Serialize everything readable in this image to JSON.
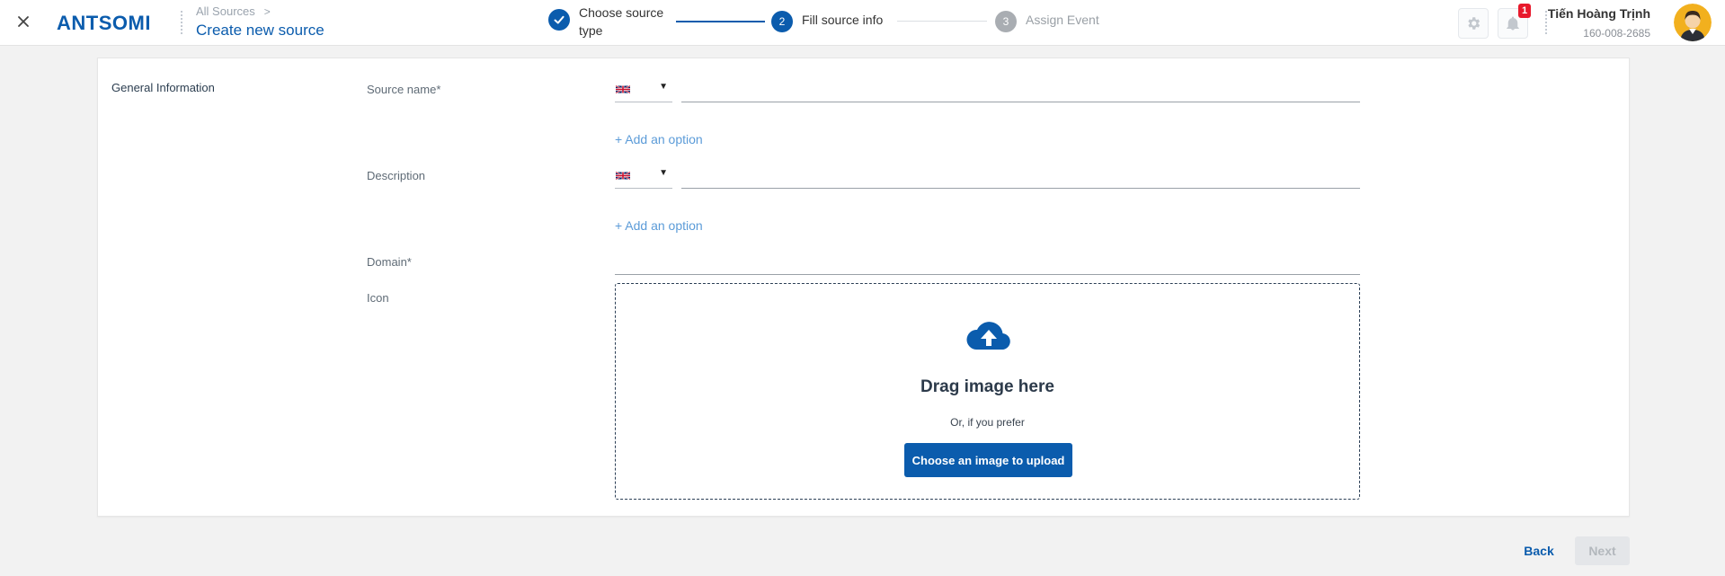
{
  "header": {
    "logo_text": "ANTSOMI",
    "breadcrumb_parent": "All Sources",
    "breadcrumb_chevron": ">",
    "page_title": "Create new source"
  },
  "stepper": {
    "steps": [
      {
        "number": "1",
        "label": "Choose source type",
        "state": "completed"
      },
      {
        "number": "2",
        "label": "Fill source info",
        "state": "active"
      },
      {
        "number": "3",
        "label": "Assign Event",
        "state": "pending"
      }
    ],
    "colors": {
      "active": "#0b5cad",
      "pending": "#a9adb2"
    }
  },
  "user": {
    "name": "Tiến Hoàng Trịnh",
    "phone": "160-008-2685",
    "notification_count": "1"
  },
  "form": {
    "section_title": "General Information",
    "source_name_label": "Source name*",
    "description_label": "Description",
    "domain_label": "Domain*",
    "icon_label": "Icon",
    "add_option_label": "+ Add an option",
    "language_icon": "uk-flag-icon",
    "source_name_value": "",
    "description_value": "",
    "domain_value": ""
  },
  "dropzone": {
    "title": "Drag image here",
    "subtitle": "Or, if you prefer",
    "button_label": "Choose an image to upload"
  },
  "footer": {
    "back_label": "Back",
    "next_label": "Next"
  },
  "colors": {
    "brand_blue": "#0b5cad",
    "link_blue": "#5b9bd8",
    "badge_red": "#e8192c"
  }
}
